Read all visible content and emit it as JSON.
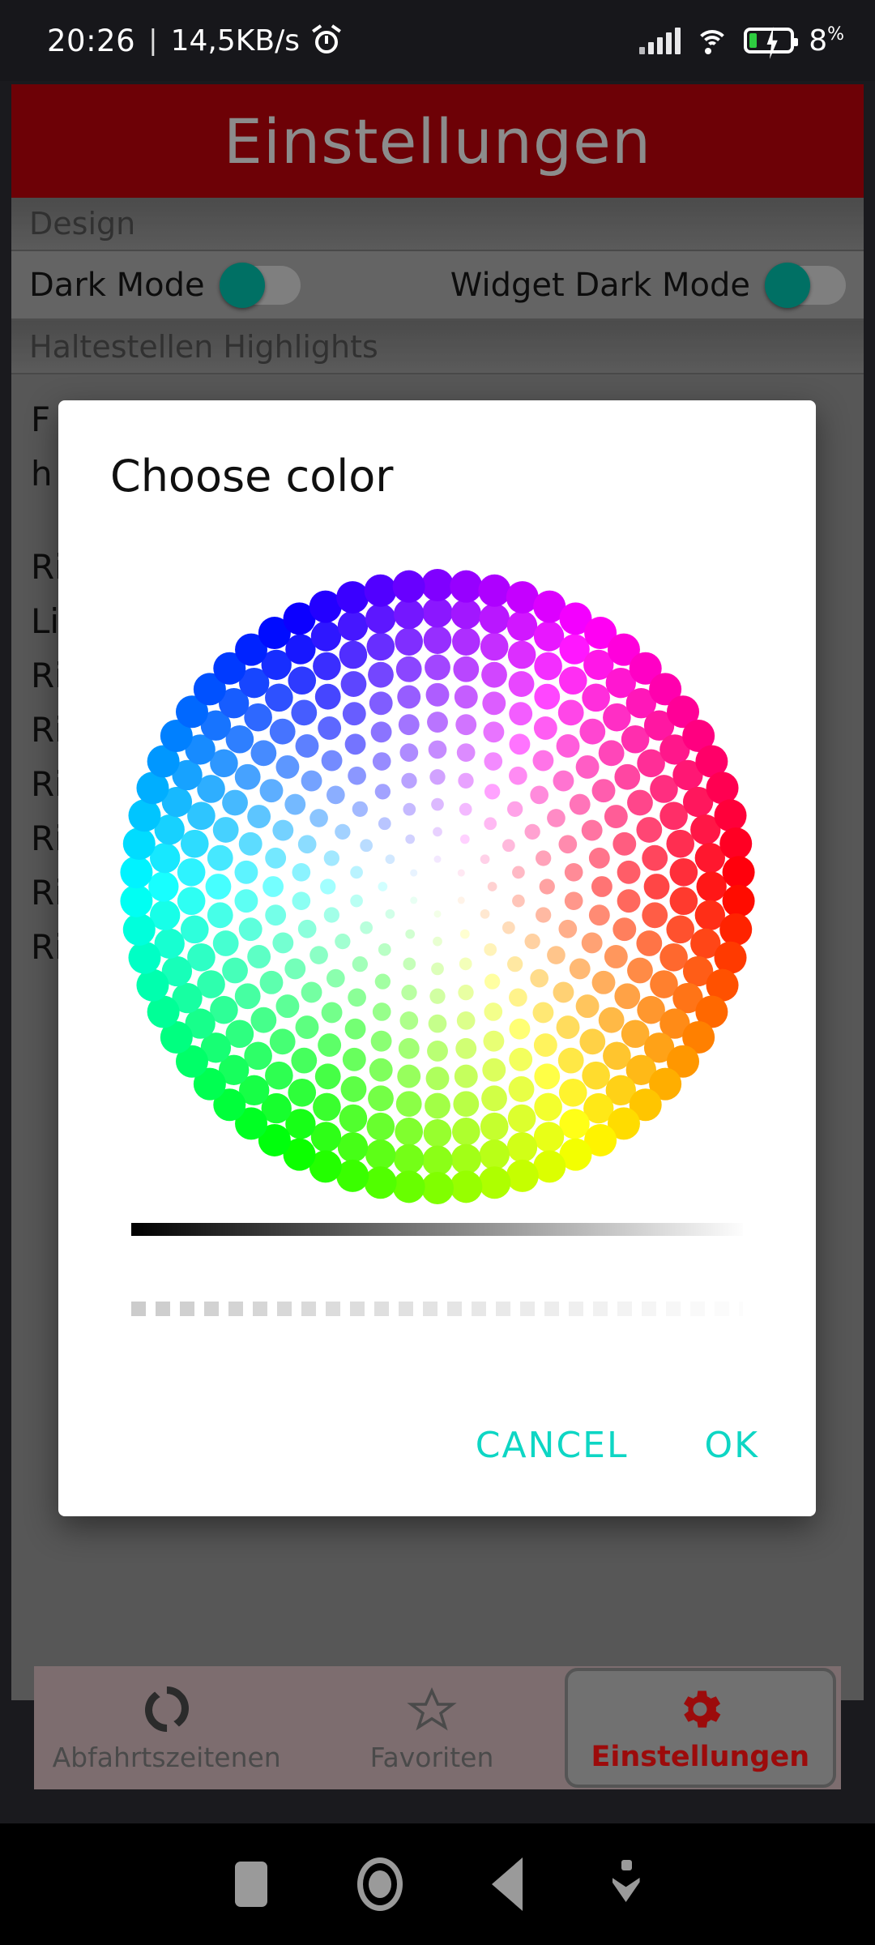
{
  "status_bar": {
    "time": "20:26",
    "separator": "|",
    "net_rate": "14,5KB/s",
    "alarm_icon": "alarm-clock-icon",
    "signal_icon": "cellular-signal-icon",
    "wifi_icon": "wifi-icon",
    "battery_icon": "battery-charging-icon",
    "battery_percent": "8",
    "battery_unit": "%"
  },
  "app_header": {
    "title": "Einstellungen",
    "bg_color": "#6d0106",
    "text_color": "#8c8c8c"
  },
  "settings": {
    "sections": [
      {
        "label": "Design"
      },
      {
        "label": "Haltestellen Highlights"
      }
    ],
    "design_row": {
      "dark_mode_label": "Dark Mode",
      "dark_mode_state": "off",
      "widget_dark_mode_label": "Widget Dark Mode",
      "widget_dark_mode_state": "off",
      "toggle_color": "#00897a"
    },
    "highlight_rows": [
      {
        "label": "F"
      },
      {
        "label": "h"
      },
      {
        "label": "Ri"
      },
      {
        "label": "Li"
      },
      {
        "label": "Ri"
      },
      {
        "label": "Ri"
      },
      {
        "label": "Ri"
      },
      {
        "label": "Ri"
      },
      {
        "label": "Ri"
      },
      {
        "label": "Ri"
      }
    ],
    "swatches": [
      {
        "name": "rainbow-color-swatch"
      },
      {
        "name": "green-ring-swatch"
      }
    ]
  },
  "dialog": {
    "title": "Choose color",
    "picker_type": "hsv-dot-wheel",
    "value_slider": {
      "name": "value-brightness-slider",
      "from": "#000000",
      "to": "#ffffff",
      "position": 1.0
    },
    "alpha_slider": {
      "name": "alpha-slider",
      "checker_color": "#cccccc",
      "position": 1.0
    },
    "cancel_label": "CANCEL",
    "ok_label": "OK",
    "accent_color": "#0ed6c4"
  },
  "tabbar": {
    "tabs": [
      {
        "label": "Abfahrtszeitenen",
        "icon": "refresh-icon",
        "selected": false
      },
      {
        "label": "Favoriten",
        "icon": "star-icon",
        "selected": false
      },
      {
        "label": "Einstellungen",
        "icon": "gear-icon",
        "selected": true
      }
    ],
    "selected_color": "#9c0b0b"
  },
  "android_nav": {
    "recents_icon": "square-recents-icon",
    "home_icon": "circle-home-icon",
    "back_icon": "triangle-back-icon",
    "dismiss_icon": "chevron-down-dismiss-icon"
  }
}
